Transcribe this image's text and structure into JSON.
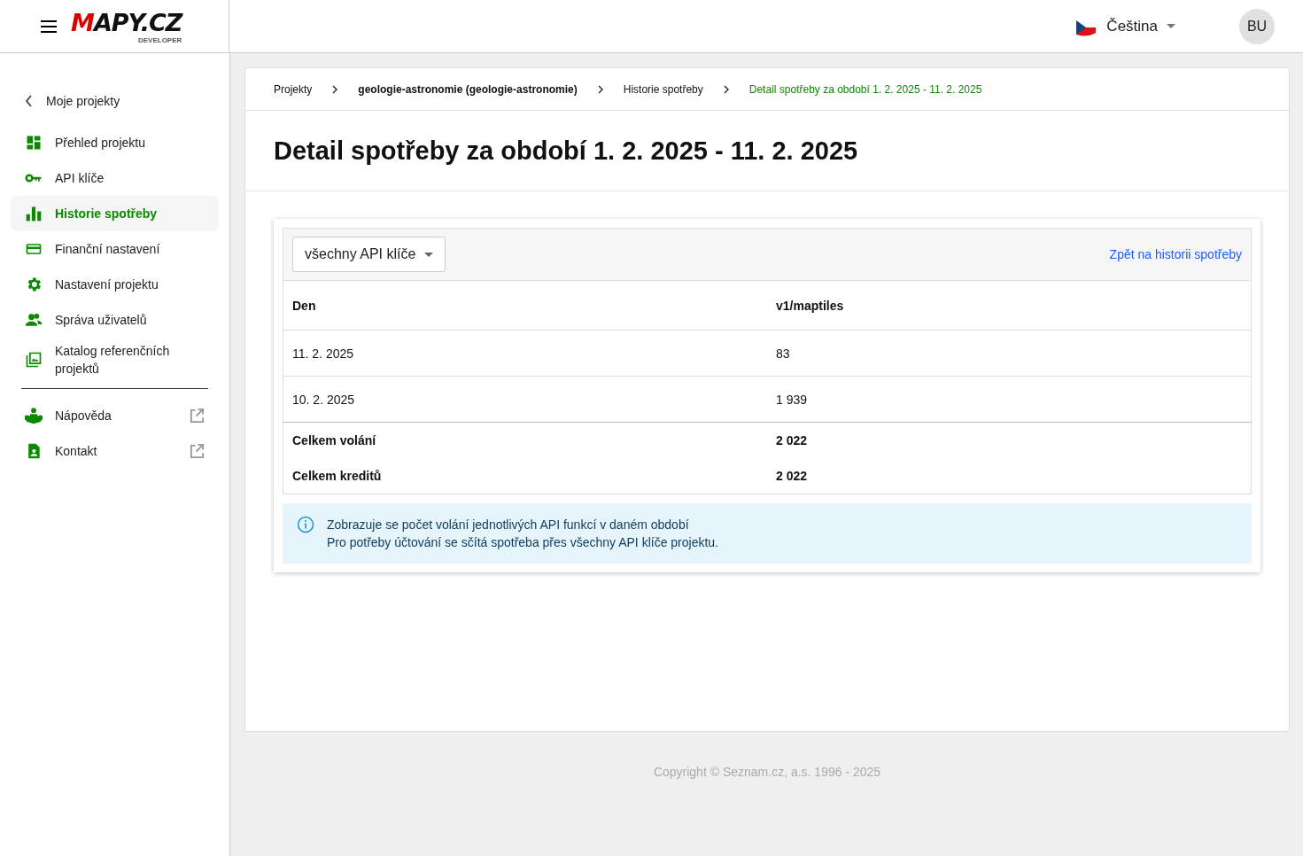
{
  "header": {
    "logo": "MAPY.CZ",
    "logo_sub": "DEVELOPER",
    "language": "Čeština",
    "avatar": "BU"
  },
  "sidebar": {
    "back": "Moje projekty",
    "items": [
      {
        "label": "Přehled projektu",
        "selected": false
      },
      {
        "label": "API klíče",
        "selected": false
      },
      {
        "label": "Historie spotřeby",
        "selected": true
      },
      {
        "label": "Finanční nastavení",
        "selected": false
      },
      {
        "label": "Nastavení projektu",
        "selected": false
      },
      {
        "label": "Správa uživatelů",
        "selected": false
      },
      {
        "label": "Katalog referenčních projektů",
        "selected": false
      }
    ],
    "links": [
      {
        "label": "Nápověda"
      },
      {
        "label": "Kontakt"
      }
    ]
  },
  "breadcrumbs": [
    {
      "label": "Projekty",
      "kind": "plain"
    },
    {
      "label": "geologie-astronomie (geologie-astronomie)",
      "kind": "bold"
    },
    {
      "label": "Historie spotřeby",
      "kind": "plain"
    },
    {
      "label": "Detail spotřeby za období 1. 2. 2025 - 11. 2. 2025",
      "kind": "current"
    }
  ],
  "title": "Detail spotřeby za období 1. 2. 2025 - 11. 2. 2025",
  "filter": {
    "value": "všechny API klíče"
  },
  "back_link": "Zpět na historii spotřeby",
  "table": {
    "columns": [
      "Den",
      "v1/maptiles"
    ],
    "rows": [
      [
        "11. 2. 2025",
        "83"
      ],
      [
        "10. 2. 2025",
        "1 939"
      ]
    ],
    "totals": [
      {
        "label": "Celkem volání",
        "value": "2 022"
      },
      {
        "label": "Celkem kreditů",
        "value": "2 022"
      }
    ]
  },
  "info": [
    "Zobrazuje se počet volání jednotlivých API funkcí v daném období",
    "Pro potřeby účtování se sčítá spotřeba přes všechny API klíče projektu."
  ],
  "footer": "Copyright © Seznam.cz, a.s. 1996 - 2025"
}
